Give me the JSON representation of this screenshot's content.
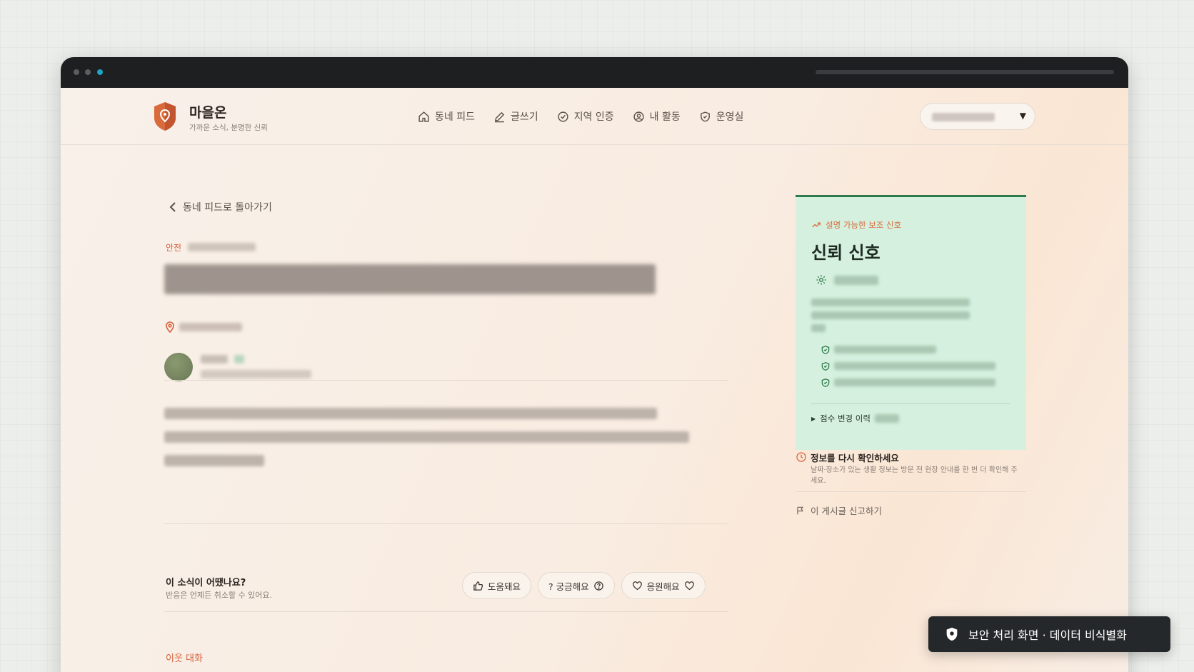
{
  "brand": {
    "name": "마을온",
    "tagline": "가까운 소식, 분명한 신뢰"
  },
  "nav": [
    {
      "icon": "home-icon",
      "label": "동네 피드"
    },
    {
      "icon": "pencil-icon",
      "label": "글쓰기"
    },
    {
      "icon": "check-circle-icon",
      "label": "지역 인증"
    },
    {
      "icon": "user-circle-icon",
      "label": "내 활동"
    },
    {
      "icon": "shield-check-icon",
      "label": "운영실"
    }
  ],
  "post": {
    "back_label": "동네 피드로 돌아가기",
    "category": "안전"
  },
  "reactions": {
    "question": "이 소식이 어땠나요?",
    "subtext": "반응은 언제든 취소할 수 있어요.",
    "buttons": [
      {
        "icon": "thumbs-up-icon",
        "label": "도움돼요"
      },
      {
        "icon": "question-icon",
        "label": "? 궁금해요"
      },
      {
        "icon": "heart-icon",
        "label": "응원해요"
      }
    ]
  },
  "comments": {
    "title": "이웃 대화"
  },
  "trust_card": {
    "kicker": "설명 가능한 보조 신호",
    "title": "신뢰 신호",
    "history_label": "점수 변경 이력"
  },
  "recheck": {
    "title": "정보를 다시 확인하세요",
    "body": "날짜·장소가 있는 생활 정보는 방문 전 현장 안내를 한 번 더 확인해 주세요."
  },
  "report_label": "이 게시글 신고하기",
  "toast": {
    "label": "보안 처리 화면 · 데이터 비식별화"
  },
  "colors": {
    "accent": "#d55f3a",
    "trust_bg": "#d5f0de",
    "trust_border": "#2e7a4a"
  }
}
